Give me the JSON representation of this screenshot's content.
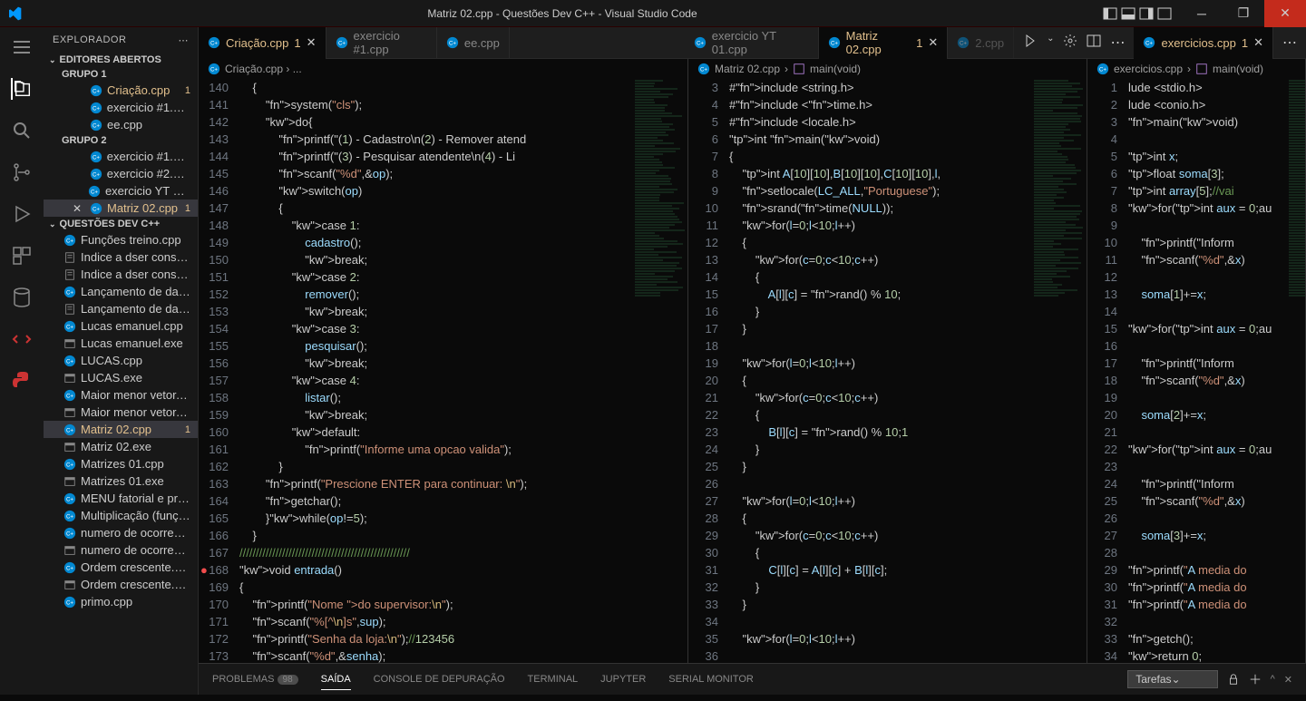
{
  "window": {
    "title": "Matriz 02.cpp - Questões Dev C++ - Visual Studio Code"
  },
  "sidebar": {
    "header": "EXPLORADOR",
    "sections": {
      "open_editors": "EDITORES ABERTOS",
      "workspace": "QUESTÕES DEV C++"
    },
    "groups": {
      "g1": "GRUPO 1",
      "g2": "GRUPO 2"
    },
    "open_editors_g1": [
      {
        "name": "Criação.cpp",
        "badge": "1",
        "modified": true
      },
      {
        "name": "exercicio #1.cpp"
      },
      {
        "name": "ee.cpp"
      }
    ],
    "open_editors_g2": [
      {
        "name": "exercicio #1.cpp"
      },
      {
        "name": "exercicio #2.cpp"
      },
      {
        "name": "exercicio YT 01.c..."
      },
      {
        "name": "Matriz 02.cpp",
        "badge": "1",
        "modified": true,
        "active": true
      }
    ],
    "files": [
      {
        "name": "Funções treino.cpp",
        "icon": "cpp"
      },
      {
        "name": "Indice a dser consulta...",
        "icon": "txt"
      },
      {
        "name": "Indice a dser consulta...",
        "icon": "txt"
      },
      {
        "name": "Lançamento de dado...",
        "icon": "cpp"
      },
      {
        "name": "Lançamento de dado...",
        "icon": "txt"
      },
      {
        "name": "Lucas emanuel.cpp",
        "icon": "cpp"
      },
      {
        "name": "Lucas emanuel.exe",
        "icon": "exe"
      },
      {
        "name": "LUCAS.cpp",
        "icon": "cpp"
      },
      {
        "name": "LUCAS.exe",
        "icon": "exe"
      },
      {
        "name": "Maior menor vetor.cpp",
        "icon": "cpp"
      },
      {
        "name": "Maior menor vetor.exe",
        "icon": "exe"
      },
      {
        "name": "Matriz 02.cpp",
        "icon": "cpp",
        "modified": true,
        "badge": "1",
        "active": true
      },
      {
        "name": "Matriz 02.exe",
        "icon": "exe"
      },
      {
        "name": "Matrizes 01.cpp",
        "icon": "cpp"
      },
      {
        "name": "Matrizes 01.exe",
        "icon": "exe"
      },
      {
        "name": "MENU fatorial e prim...",
        "icon": "cpp"
      },
      {
        "name": "Multiplicação (funçõe...",
        "icon": "cpp"
      },
      {
        "name": "numero de ocorrenci...",
        "icon": "cpp"
      },
      {
        "name": "numero de ocorrenci...",
        "icon": "exe"
      },
      {
        "name": "Ordem crescente.cpp",
        "icon": "cpp"
      },
      {
        "name": "Ordem crescente.exe",
        "icon": "exe"
      },
      {
        "name": "primo.cpp",
        "icon": "cpp"
      }
    ]
  },
  "tabs_g1": [
    {
      "label": "Criação.cpp",
      "badge": "1",
      "active": true,
      "modified": true
    },
    {
      "label": "exercicio #1.cpp"
    },
    {
      "label": "ee.cpp"
    }
  ],
  "tabs_g2": [
    {
      "label": "exercicio YT 01.cpp"
    },
    {
      "label": "Matriz 02.cpp",
      "badge": "1",
      "active": true,
      "modified": true
    },
    {
      "label": "2.cpp",
      "dim": true
    }
  ],
  "tabs_g3": [
    {
      "label": "exercicios.cpp",
      "badge": "1",
      "active": true,
      "modified": true
    }
  ],
  "breadcrumbs": {
    "p1": "Criação.cpp › ...",
    "p2a": "Matriz 02.cpp",
    "p2b": "main(void)",
    "p3a": "exercicios.cpp",
    "p3b": "main(void)"
  },
  "pane1_start": 140,
  "pane1_lines": [
    "    {",
    "        system(\"cls\");",
    "        do{",
    "            printf(\"(1) - Cadastro\\n(2) - Remover atend",
    "            printf(\"(3) - Pesquisar atendente\\n(4) - Li",
    "            scanf(\"%d\",&op);",
    "            switch(op)",
    "            {",
    "                case 1:",
    "                    cadastro();",
    "                    break;",
    "                case 2:",
    "                    remover();",
    "                    break;",
    "                case 3:",
    "                    pesquisar();",
    "                    break;",
    "                case 4:",
    "                    listar();",
    "                    break;",
    "                default:",
    "                    printf(\"Informe uma opcao valida\");",
    "            }",
    "        printf(\"Prescione ENTER para continuar: \\n\");",
    "        getchar();",
    "        }while(op!=5);",
    "    }",
    "////////////////////////////////////////////////////",
    "void entrada()",
    "{",
    "    printf(\"Nome do supervisor:\\n\");",
    "    scanf(\"%[^\\n]s\",sup);",
    "    printf(\"Senha da loja:\\n\");//123456",
    "    scanf(\"%d\",&senha);"
  ],
  "pane2_start": 3,
  "pane2_lines": [
    "#include <string.h>",
    "#include <time.h>",
    "#include <locale.h>",
    "int main(void)",
    "{",
    "    int A[10][10],B[10][10],C[10][10],l,",
    "    setlocale(LC_ALL,\"Portuguese\");",
    "    srand(time(NULL));",
    "    for(l=0;l<10;l++)",
    "    {",
    "        for(c=0;c<10;c++)",
    "        {",
    "            A[l][c] = rand() % 10;",
    "        }",
    "    }",
    "",
    "    for(l=0;l<10;l++)",
    "    {",
    "        for(c=0;c<10;c++)",
    "        {",
    "            B[l][c] = rand() % 10;1",
    "        }",
    "    }",
    "",
    "    for(l=0;l<10;l++)",
    "    {",
    "        for(c=0;c<10;c++)",
    "        {",
    "            C[l][c] = A[l][c] + B[l][c];",
    "        }",
    "    }",
    "",
    "    for(l=0;l<10;l++)",
    ""
  ],
  "pane3_start": 1,
  "pane3_lines": [
    "lude <stdio.h>",
    "lude <conio.h>",
    "main(void)",
    "",
    "int x;",
    "float soma[3];",
    "int array[5];//vai",
    "for(int aux = 0;au",
    "",
    "    printf(\"Inform",
    "    scanf(\"%d\",&x)",
    "",
    "    soma[1]+=x;",
    "",
    "for(int aux = 0;au",
    "",
    "    printf(\"Inform",
    "    scanf(\"%d\",&x)",
    "",
    "    soma[2]+=x;",
    "",
    "for(int aux = 0;au",
    "",
    "    printf(\"Inform",
    "    scanf(\"%d\",&x)",
    "",
    "    soma[3]+=x;",
    "",
    "printf(\"A media do",
    "printf(\"A media do",
    "printf(\"A media do",
    "",
    "getch();",
    "return 0;"
  ],
  "bottom": {
    "problemas": "PROBLEMAS",
    "problemas_count": "98",
    "saida": "SAÍDA",
    "console": "CONSOLE DE DEPURAÇÃO",
    "terminal": "TERMINAL",
    "jupyter": "JUPYTER",
    "serial": "SERIAL MONITOR",
    "tarefas": "Tarefas"
  }
}
